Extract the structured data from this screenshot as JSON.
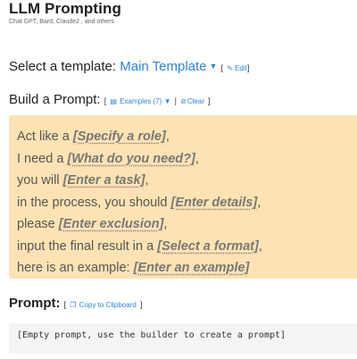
{
  "header": {
    "title": "LLM Prompting",
    "subtitle": "Chat GPT, Bard, Claude2 , and others"
  },
  "template": {
    "label": "Select a template:",
    "selected": "Main Template",
    "edit_label": "Edit"
  },
  "builder": {
    "label": "Build a Prompt:",
    "examples_label": "Examples (7)",
    "clear_label": "Clear",
    "lines": [
      {
        "prefix": "Act like a ",
        "placeholder": "[Specify a role]",
        "suffix": ","
      },
      {
        "prefix": "I need a ",
        "placeholder": "[What do you need?]",
        "suffix": ","
      },
      {
        "prefix": "you will ",
        "placeholder": "[Enter a task]",
        "suffix": ","
      },
      {
        "prefix": "in the process, you should ",
        "placeholder": "[Enter details]",
        "suffix": ","
      },
      {
        "prefix": "please ",
        "placeholder": "[Enter exclusion]",
        "suffix": ","
      },
      {
        "prefix": "input the final result in a ",
        "placeholder": "[Select a format]",
        "suffix": ","
      },
      {
        "prefix": "here is an example: ",
        "placeholder": "[Enter an example]",
        "suffix": ""
      }
    ]
  },
  "prompt": {
    "label": "Prompt:",
    "copy_label": "Copy to Clipboard",
    "output": "[Empty prompt, use the builder to create a prompt]"
  },
  "colors": {
    "accent": "#2f86d6",
    "builder_bg": "#fde3b3",
    "output_bg": "#f4f4f4"
  }
}
